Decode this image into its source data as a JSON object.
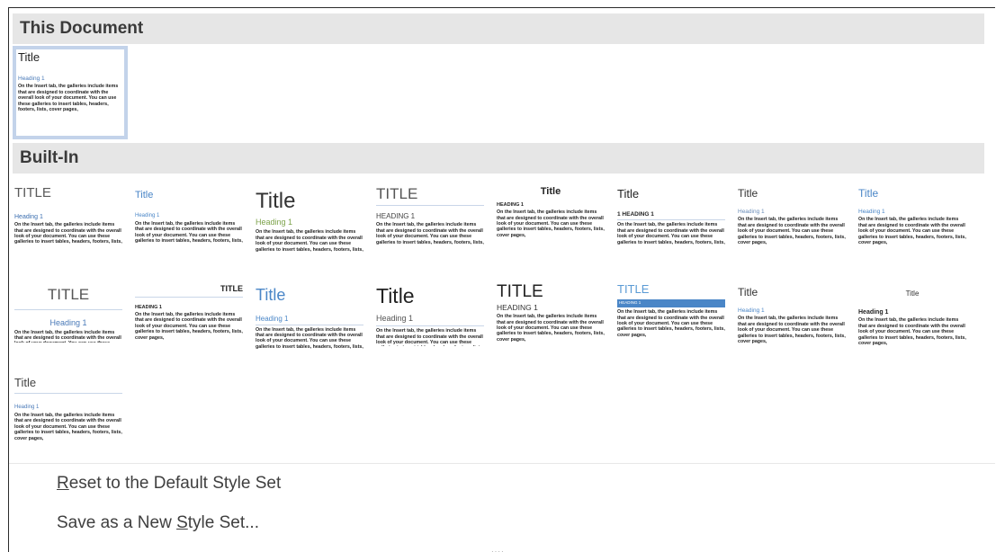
{
  "sections": {
    "this_document": "This Document",
    "built_in": "Built-In"
  },
  "sample": {
    "title": "Title",
    "heading": "Heading 1",
    "body": "On the Insert tab, the galleries include items that are designed to coordinate with the overall look of your document. You can use these galleries to insert tables, headers, footers, lists, cover pages,"
  },
  "this_document_style": {
    "title": "Title",
    "heading": "Heading 1",
    "body": "On the Insert tab, the galleries include items that are designed to coordinate with the overall look of your document. You can use these galleries to insert tables, headers, footers, lists, cover pages,"
  },
  "styles": [
    {
      "title": "TITLE",
      "heading": "Heading 1"
    },
    {
      "title": "Title",
      "heading": "Heading 1"
    },
    {
      "title": "Title",
      "heading": "Heading 1"
    },
    {
      "title": "TITLE",
      "heading": "HEADING 1"
    },
    {
      "title": "Title",
      "heading": "HEADING 1"
    },
    {
      "title": "Title",
      "heading": "1 HEADING 1"
    },
    {
      "title": "Title",
      "heading": "Heading 1"
    },
    {
      "title": "Title",
      "heading": "Heading 1"
    },
    {
      "title": "TITLE",
      "heading": "Heading 1"
    },
    {
      "title": "TITLE",
      "heading": "HEADING 1"
    },
    {
      "title": "Title",
      "heading": "Heading 1"
    },
    {
      "title": "Title",
      "heading": "Heading 1"
    },
    {
      "title": "TITLE",
      "heading": "HEADING 1"
    },
    {
      "title": "TITLE",
      "heading": "HEADING 1"
    },
    {
      "title": "Title",
      "heading": "Heading 1"
    },
    {
      "title": "Title",
      "heading": "Heading 1"
    },
    {
      "title": "Title",
      "heading": "Heading 1"
    }
  ],
  "menu": {
    "reset": {
      "accel": "R",
      "rest": "eset to the Default Style Set"
    },
    "save": {
      "before": "Save as a New ",
      "accel": "S",
      "after": "tyle Set..."
    }
  },
  "resize_grip": "····"
}
